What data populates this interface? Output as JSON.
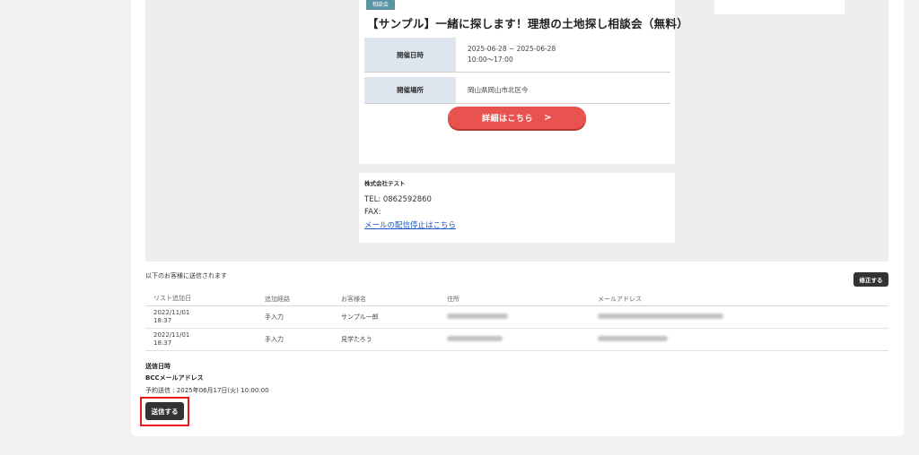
{
  "event": {
    "badge": "相談会",
    "title": "【サンプル】一緒に探します！理想の土地探し相談会（無料）",
    "date_label": "開催日時",
    "date_range": "2025-06-28 ~ 2025-06-28",
    "time_range": "10:00〜17:00",
    "place_label": "開催場所",
    "place_value": "岡山県岡山市北区今",
    "detail_button": "詳細はこちら",
    "detail_chevron": "chevron-right-icon"
  },
  "company": {
    "name": "株式会社テスト",
    "tel": "TEL: 0862592860",
    "fax": "FAX:",
    "unsubscribe": "メールの配信停止はこちら",
    "link_color": "#1a56c9"
  },
  "recipients": {
    "label": "以下のお客様に送信されます",
    "edit_button": "修正する",
    "columns": [
      "リスト追加日",
      "追加経路",
      "お客様名",
      "住所",
      "メールアドレス"
    ],
    "rows": [
      {
        "date": "2022/11/01",
        "time": "18:37",
        "route": "手入力",
        "name": "サンプル一郎"
      },
      {
        "date": "2022/11/01",
        "time": "18:37",
        "route": "手入力",
        "name": "見学たろう"
      }
    ]
  },
  "send": {
    "date_label": "送信日時",
    "bcc_label": "BCCメールアドレス",
    "scheduled": "予約送信 : 2025年06月17日(火) 10:00:00",
    "button": "送信する",
    "highlight_color": "#e8191a"
  },
  "colors": {
    "accent_red": "#e8534f",
    "badge_teal": "#5a93a4",
    "dark_button": "#333333"
  }
}
